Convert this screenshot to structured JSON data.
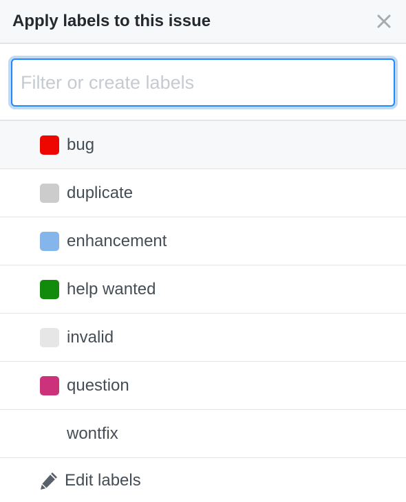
{
  "header": {
    "title": "Apply labels to this issue"
  },
  "search": {
    "placeholder": "Filter or create labels",
    "value": ""
  },
  "labels": [
    {
      "name": "bug",
      "color": "#ee0701"
    },
    {
      "name": "duplicate",
      "color": "#cccccc"
    },
    {
      "name": "enhancement",
      "color": "#84b6eb"
    },
    {
      "name": "help wanted",
      "color": "#128a0c"
    },
    {
      "name": "invalid",
      "color": "#e6e6e6"
    },
    {
      "name": "question",
      "color": "#cc317c"
    },
    {
      "name": "wontfix",
      "color": "#ffffff"
    }
  ],
  "footer": {
    "edit_label": "Edit labels",
    "icon": "pencil-icon"
  },
  "close_icon": "close-icon"
}
